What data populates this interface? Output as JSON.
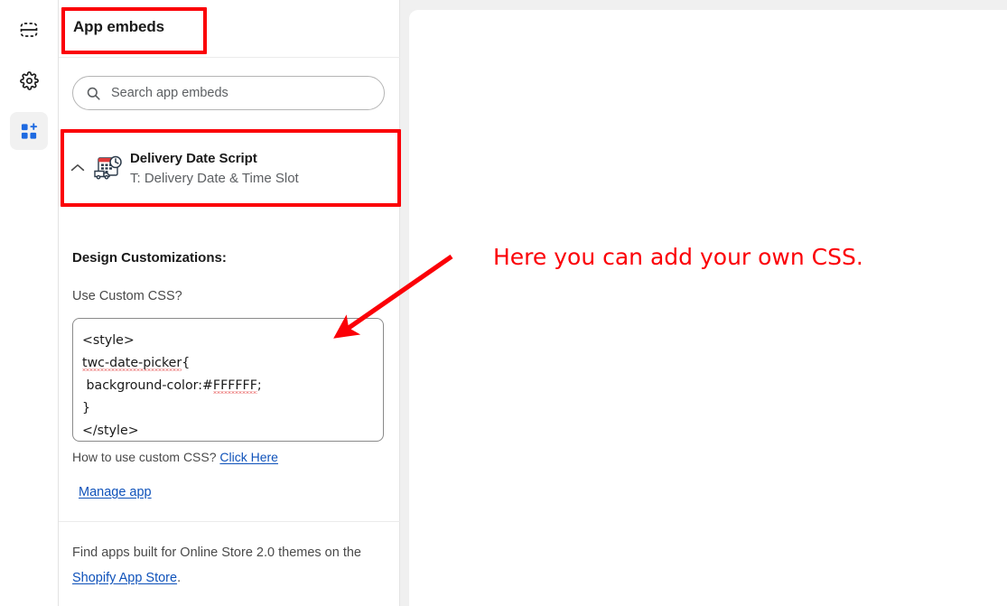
{
  "rail": {
    "items": [
      {
        "name": "sections-icon",
        "label": "Sections"
      },
      {
        "name": "settings-gear-icon",
        "label": "Theme settings"
      },
      {
        "name": "app-blocks-icon",
        "label": "Apps",
        "selected": true
      }
    ]
  },
  "panel": {
    "title": "App embeds",
    "search": {
      "placeholder": "Search app embeds",
      "value": "",
      "icon": "search-icon"
    },
    "embed": {
      "chevron": "chevron-up-icon",
      "app_icon": "delivery-calendar-clock-icon",
      "title": "Delivery Date Script",
      "subtitle": "T: Delivery Date & Time Slot",
      "toggle_state": "on"
    },
    "section_heading": "Design Customizations:",
    "css_field": {
      "label": "Use Custom CSS?",
      "lines": [
        "<style>",
        ".twc-date-picker{",
        "  background-color:#FFFFFF;",
        "}",
        "</style>"
      ],
      "misspelled": [
        "twc-date-picker",
        "FFFFFF"
      ]
    },
    "help": {
      "text": "How to use custom CSS?",
      "link": "Click Here"
    },
    "manage_link": "Manage app",
    "footnote": {
      "prefix": "Find apps built for Online Store 2.0 themes on the ",
      "link": "Shopify App Store",
      "suffix": "."
    }
  },
  "annotations": {
    "callout_text": "Here you can add your own CSS.",
    "color": "#fb0007",
    "boxes": [
      {
        "name": "highlight-app-embeds-title"
      },
      {
        "name": "highlight-delivery-date-script-row"
      }
    ]
  },
  "colors": {
    "accent_link": "#0f52ba",
    "annotation_red": "#fb0007",
    "toggle_on": "#303030",
    "panel_border": "#e3e3e3",
    "stage_bg": "#f0f0f0"
  }
}
